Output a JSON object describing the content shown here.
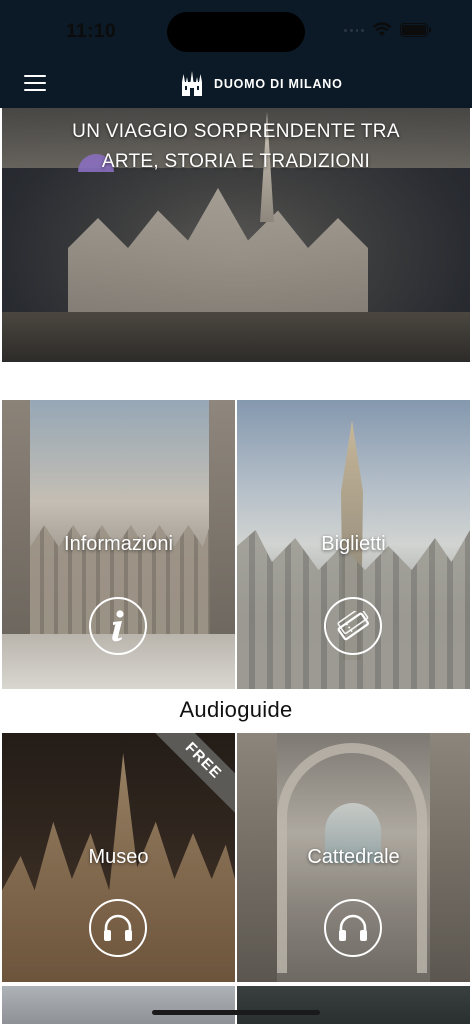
{
  "status_bar": {
    "time": "11:10"
  },
  "header": {
    "title": "DUOMO DI MILANO",
    "menu_icon": "hamburger-menu-icon",
    "logo_icon": "duomo-logo-icon",
    "background": "#0b1a26"
  },
  "hero": {
    "line1": "UN VIAGGIO SORPRENDENTE TRA",
    "line2": "ARTE, STORIA E TRADIZIONI"
  },
  "tiles": [
    {
      "label": "Informazioni",
      "icon": "info-icon"
    },
    {
      "label": "Biglietti",
      "icon": "ticket-icon"
    }
  ],
  "audioguide": {
    "title": "Audioguide",
    "tiles": [
      {
        "label": "Museo",
        "icon": "headphones-icon",
        "badge": "FREE"
      },
      {
        "label": "Cattedrale",
        "icon": "headphones-icon"
      }
    ]
  }
}
